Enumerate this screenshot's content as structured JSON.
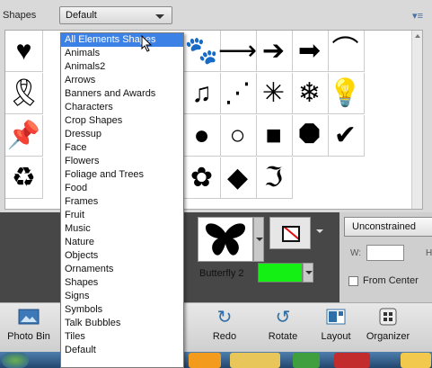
{
  "shapes_panel": {
    "label": "Shapes",
    "selected_value": "Default",
    "menu_icon": "▾≡"
  },
  "grid_shapes": [
    {
      "glyph": "♥"
    },
    {
      "glyph": "🐾"
    },
    {
      "glyph": "⟶"
    },
    {
      "glyph": "➔"
    },
    {
      "glyph": "➡"
    },
    {
      "glyph": "⌒"
    },
    {
      "glyph": "🎗"
    },
    {
      "glyph": "♫"
    },
    {
      "glyph": "⋰"
    },
    {
      "glyph": "✳"
    },
    {
      "glyph": "❄"
    },
    {
      "glyph": "💡"
    },
    {
      "glyph": "📌"
    },
    {
      "glyph": "●"
    },
    {
      "glyph": "○"
    },
    {
      "glyph": "■"
    },
    {
      "glyph": "⯃"
    },
    {
      "glyph": "✔"
    },
    {
      "glyph": "♻"
    },
    {
      "glyph": "✿"
    },
    {
      "glyph": "◆"
    },
    {
      "glyph": "ℑ"
    }
  ],
  "dropdown": {
    "items": [
      "All Elements Shapes",
      "Animals",
      "Animals2",
      "Arrows",
      "Banners and Awards",
      "Characters",
      "Crop Shapes",
      "Dressup",
      "Face",
      "Flowers",
      "Foliage and Trees",
      "Food",
      "Frames",
      "Fruit",
      "Music",
      "Nature",
      "Objects",
      "Ornaments",
      "Shapes",
      "Signs",
      "Symbols",
      "Talk Bubbles",
      "Tiles",
      "Default"
    ],
    "selected_index": 0
  },
  "tool_options": {
    "shape_name": "Butterfly 2",
    "fill_color": "#14f014",
    "constraint": "Unconstrained",
    "w_label": "W:",
    "h_label": "H",
    "from_center_label": "From Center"
  },
  "bottom_bar": {
    "buttons": [
      {
        "label": "Photo Bin",
        "icon": "photo-bin-icon"
      },
      {
        "label": "Redo",
        "icon": "redo-icon"
      },
      {
        "label": "Rotate",
        "icon": "rotate-icon"
      },
      {
        "label": "Layout",
        "icon": "layout-icon"
      },
      {
        "label": "Organizer",
        "icon": "organizer-icon"
      }
    ]
  },
  "colors": {
    "selection": "#3c82e6",
    "panel": "#d9d9d9",
    "options_bg": "#474747"
  }
}
